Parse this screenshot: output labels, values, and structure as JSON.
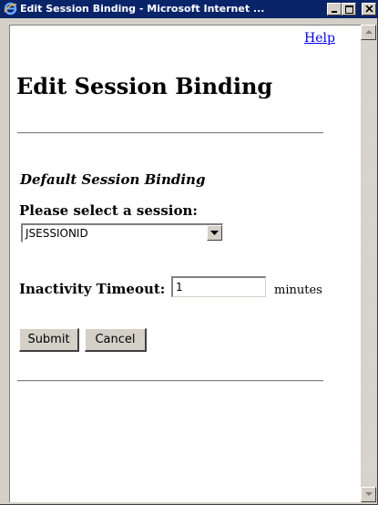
{
  "window": {
    "title": "Edit Session Binding - Microsoft Internet ..."
  },
  "page": {
    "help_link": "Help",
    "title": "Edit Session Binding",
    "section_heading": "Default Session Binding",
    "select_label": "Please select a session:",
    "selected_session": "JSESSIONID",
    "timeout_label": "Inactivity Timeout:",
    "timeout_value": "1",
    "timeout_unit": "minutes",
    "submit_label": "Submit",
    "cancel_label": "Cancel"
  },
  "colors": {
    "titlebar": "#0a246a",
    "link": "#0000ee",
    "chrome": "#d4d0c8"
  }
}
